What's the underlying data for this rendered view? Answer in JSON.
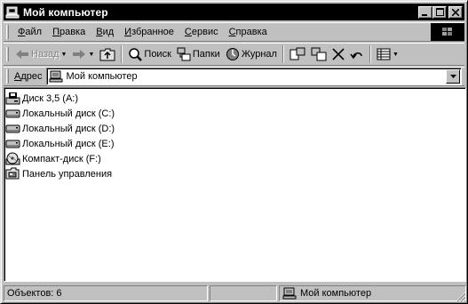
{
  "window": {
    "title": "Мой компьютер",
    "controls": [
      "minimize-icon",
      "maximize-icon",
      "close-icon"
    ]
  },
  "menubar": {
    "items": [
      {
        "u": "Ф",
        "rest": "айл"
      },
      {
        "u": "П",
        "rest": "равка"
      },
      {
        "u": "В",
        "rest": "ид"
      },
      {
        "u": "И",
        "rest": "збранное"
      },
      {
        "u": "С",
        "rest": "ервис"
      },
      {
        "u": "С",
        "rest": "правка"
      }
    ]
  },
  "toolbar": {
    "back_label": "Назад",
    "search_label": "Поиск",
    "folders_label": "Папки",
    "history_label": "Журнал"
  },
  "address": {
    "label_u": "А",
    "label_rest": "дрес",
    "value": "Мой компьютер"
  },
  "drives": [
    {
      "label": "Диск 3,5 (A:)",
      "icon": "floppy-drive-icon"
    },
    {
      "label": "Локальный диск (C:)",
      "icon": "hard-drive-icon"
    },
    {
      "label": "Локальный диск (D:)",
      "icon": "hard-drive-icon"
    },
    {
      "label": "Локальный диск (E:)",
      "icon": "hard-drive-icon"
    },
    {
      "label": "Компакт-диск (F:)",
      "icon": "cd-drive-icon"
    },
    {
      "label": "Панель управления",
      "icon": "control-panel-icon"
    }
  ],
  "status": {
    "objects": "Объектов: 6",
    "location": "Мой компьютер"
  }
}
